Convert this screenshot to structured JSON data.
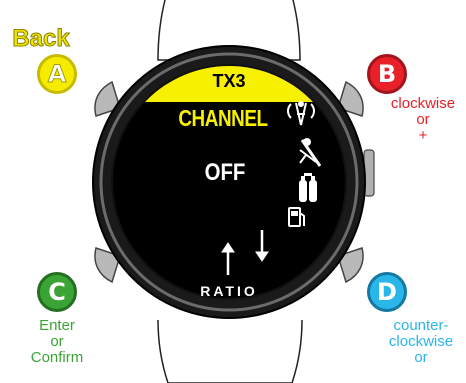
{
  "screen": {
    "header": "TX3",
    "title": "CHANNEL",
    "value": "OFF",
    "brand": "RATIO",
    "header_color": "#f7f000",
    "title_color": "#f7f000"
  },
  "buttons": {
    "a": {
      "letter": "A",
      "caption": "Back",
      "color": "#f2e400"
    },
    "b": {
      "letter": "B",
      "caption_lines": [
        "clockwise",
        "or",
        "+"
      ],
      "color": "#e8202a"
    },
    "c": {
      "letter": "C",
      "caption_lines": [
        "Enter",
        "or",
        "Confirm"
      ],
      "color": "#3aa535"
    },
    "d": {
      "letter": "D",
      "caption_lines": [
        "counter-",
        "clockwise",
        "or"
      ],
      "color": "#29b6e8"
    }
  },
  "icons": {
    "side": [
      "antenna-icon",
      "no-diver-icon",
      "tanks-icon",
      "gas-pump-icon"
    ],
    "bottom": [
      "up-arrow-icon",
      "down-arrow-icon"
    ]
  }
}
